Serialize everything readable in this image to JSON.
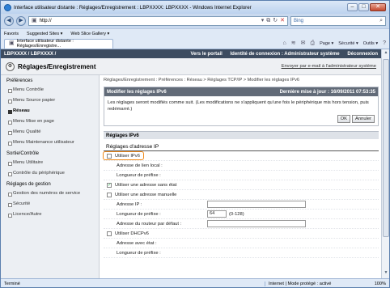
{
  "window": {
    "title": "Interface utilisateur distante : Réglages/Enregistrement : LBPXXXX: LBPXXXX - Windows Internet Explorer"
  },
  "address": {
    "url": "http://",
    "search_placeholder": "Bing"
  },
  "favbar": {
    "favorites": "Favoris",
    "suggested": "Suggested Sites ▾",
    "webslice": "Web Slice Gallery ▾"
  },
  "tab": {
    "label": "Interface utilisateur distante : Réglages/Enregistre..."
  },
  "tools": {
    "page": "Page ▾",
    "security": "Sécurité ▾",
    "tools": "Outils ▾"
  },
  "topbar": {
    "model": "LBPXXXX / LBPXXXX /",
    "portal": "Vers le portail",
    "login": "Identité de connexion : Administrateur système",
    "logout": "Déconnexion"
  },
  "header": {
    "title": "Réglages/Enregistrement",
    "mail": "Envoyer par e-mail à l'administrateur système"
  },
  "sidebar": {
    "groups": [
      {
        "label": "Préférences",
        "items": [
          "Menu Contrôle",
          "Menu Source papier",
          "Réseau",
          "Menu Mise en page",
          "Menu Qualité",
          "Menu Maintenance utilisateur"
        ]
      },
      {
        "label": "Sortie/Contrôle",
        "items": [
          "Menu Utilitaire",
          "Contrôle du périphérique"
        ]
      },
      {
        "label": "Réglages de gestion",
        "items": [
          "Gestion des numéros de service",
          "Sécurité",
          "Licence/Autre"
        ]
      }
    ]
  },
  "main": {
    "breadcrumb": "Réglages/Enregistrement : Préférences : Réseau > Réglages TCP/IP > Modifier les réglages IPv6",
    "panel_title": "Modifier les réglages IPv6",
    "last_update": "Dernière mise à jour : 16/09/2011 07:53:35",
    "message": "Les réglages seront modifiés comme suit. (Les modifications ne s'appliquent qu'une fois le périphérique mis hors tension, puis redémarré.)",
    "ok": "OK",
    "cancel": "Annuler",
    "section": "Réglages IPv6",
    "subsection": "Réglages d'adresse IP",
    "use_ipv6": "Utiliser IPv6",
    "link_local": "Adresse de lien local :",
    "prefix_length_label": "Longueur de préfixe :",
    "stateless": "Utiliser une adresse sans état",
    "manual": "Utiliser une adresse manuelle",
    "ip_address": "Adresse IP :",
    "prefix_length": "Longueur de préfixe :",
    "prefix_value": "64",
    "prefix_range": "(0-128)",
    "default_router": "Adresse du routeur par défaut :",
    "dhcpv6": "Utiliser DHCPv6",
    "stateful": "Adresse avec état :",
    "stateful_prefix": "Longueur de préfixe :"
  },
  "status": {
    "text": "Terminé",
    "zone": "Internet | Mode protégé : activé",
    "zoom": "100%"
  }
}
